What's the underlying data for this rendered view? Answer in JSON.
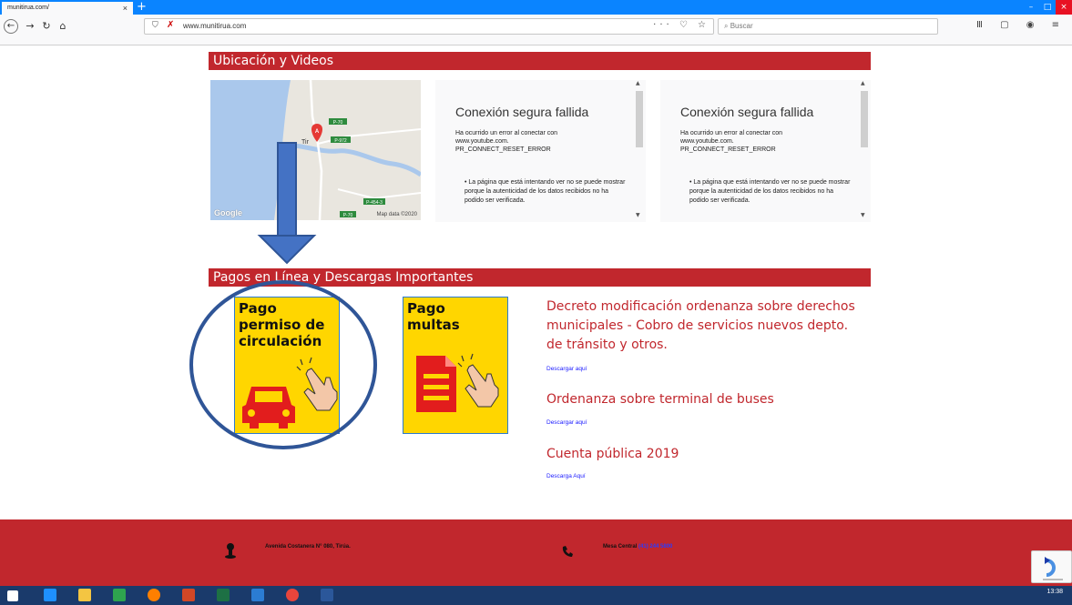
{
  "browser": {
    "tab_title": "munitirua.com/",
    "tab_close": "×",
    "new_tab": "+",
    "url": "www.munitirua.com",
    "url_tools": "··· ♡ ☆",
    "search_placeholder": "Buscar",
    "win_min": "–",
    "win_max": "□",
    "win_close": "×"
  },
  "sections": {
    "location_title": "Ubicación y Videos",
    "payments_title": "Pagos en Línea y Descargas Importantes"
  },
  "map": {
    "provider": "Google",
    "attribution": "Map data ©2020",
    "roads": [
      "P-70",
      "P-972",
      "P-454-3",
      "P-70"
    ],
    "marker_label": "A",
    "place_label": "Tir"
  },
  "videos": [
    {
      "title": "Conexión segura fallida",
      "message_line1": "Ha ocurrido un error al conectar con",
      "message_line2": "www.youtube.com.",
      "message_line3": "PR_CONNECT_RESET_ERROR",
      "bullet": "• La página que está intentando ver no se puede mostrar porque la autenticidad de los datos recibidos no ha podido ser verificada."
    },
    {
      "title": "Conexión segura fallida",
      "message_line1": "Ha ocurrido un error al conectar con",
      "message_line2": "www.youtube.com.",
      "message_line3": "PR_CONNECT_RESET_ERROR",
      "bullet": "• La página que está intentando ver no se puede mostrar porque la autenticidad de los datos recibidos no ha podido ser verificada."
    }
  ],
  "payments": [
    {
      "line1": "Pago",
      "line2": "permiso de",
      "line3": "circulación",
      "icon": "car-icon"
    },
    {
      "line1": "Pago",
      "line2": "multas",
      "line3": "",
      "icon": "document-icon"
    }
  ],
  "documents": [
    {
      "title_line1": "Decreto modificación ordenanza sobre derechos",
      "title_line2": "municipales - Cobro de servicios nuevos depto.",
      "title_line3": "de tránsito y otros.",
      "link": "Descargar aquí"
    },
    {
      "title_line1": "Ordenanza sobre terminal de buses",
      "link": "Descargar aquí"
    },
    {
      "title_line1": "Cuenta pública 2019",
      "link": "Descarga Aquí"
    }
  ],
  "footer": {
    "address": "Avenida Costanera N° 080, Tirúa.",
    "phone_label": "Mesa Central",
    "phone_number": "(41) 244 5800"
  },
  "taskbar": {
    "time": "13:38"
  },
  "colors": {
    "brand_red": "#c1272d",
    "card_yellow": "#ffd600",
    "annotation_blue": "#2f5597",
    "link_blue": "#1a1aff"
  }
}
